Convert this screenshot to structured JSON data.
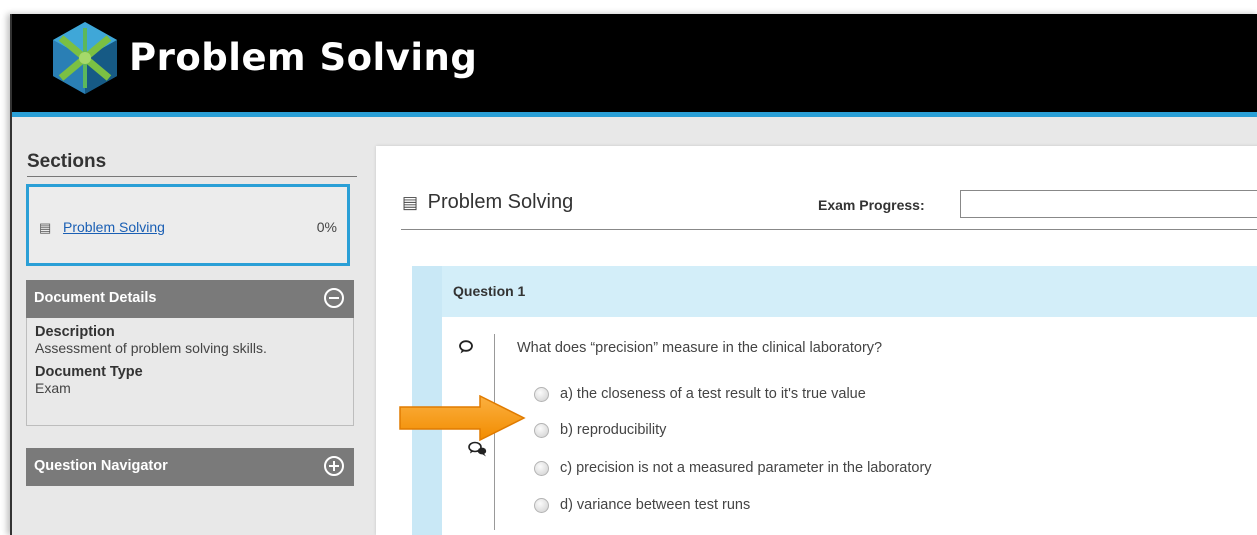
{
  "app": {
    "title": "Problem Solving",
    "logo_icon": "hexagon-cube-logo"
  },
  "sidebar": {
    "sections_title": "Sections",
    "section": {
      "icon": "document-icon",
      "label": "Problem Solving",
      "percent": "0%"
    },
    "document_details": {
      "title": "Document Details",
      "toggle_icon": "minus-circle-icon",
      "description_label": "Description",
      "description_value": "Assessment of problem solving skills.",
      "type_label": "Document Type",
      "type_value": "Exam"
    },
    "question_navigator": {
      "title": "Question Navigator",
      "toggle_icon": "plus-circle-icon"
    }
  },
  "main": {
    "title": "Problem Solving",
    "title_icon": "document-icon",
    "progress_label": "Exam Progress:",
    "progress_value": 0,
    "question": {
      "header": "Question 1",
      "text": "What does “precision” measure in the clinical laboratory?",
      "comment_icon": "speech-bubble-icon",
      "discussion_icon": "discussion-icon",
      "options": [
        {
          "label": "a) the closeness of a test result to it's true value",
          "selected": false
        },
        {
          "label": "b) reproducibility",
          "selected": false
        },
        {
          "label": "c) precision is not a measured parameter in the laboratory",
          "selected": false
        },
        {
          "label": "d) variance between test runs",
          "selected": false
        }
      ]
    }
  },
  "annotation": {
    "arrow_icon": "orange-arrow-icon",
    "arrow_color": "#f7941d"
  },
  "colors": {
    "accent": "#2a9fd6",
    "header_bg": "#000000",
    "panel_head": "#7a7a7a",
    "question_bg": "#d3eef9"
  }
}
